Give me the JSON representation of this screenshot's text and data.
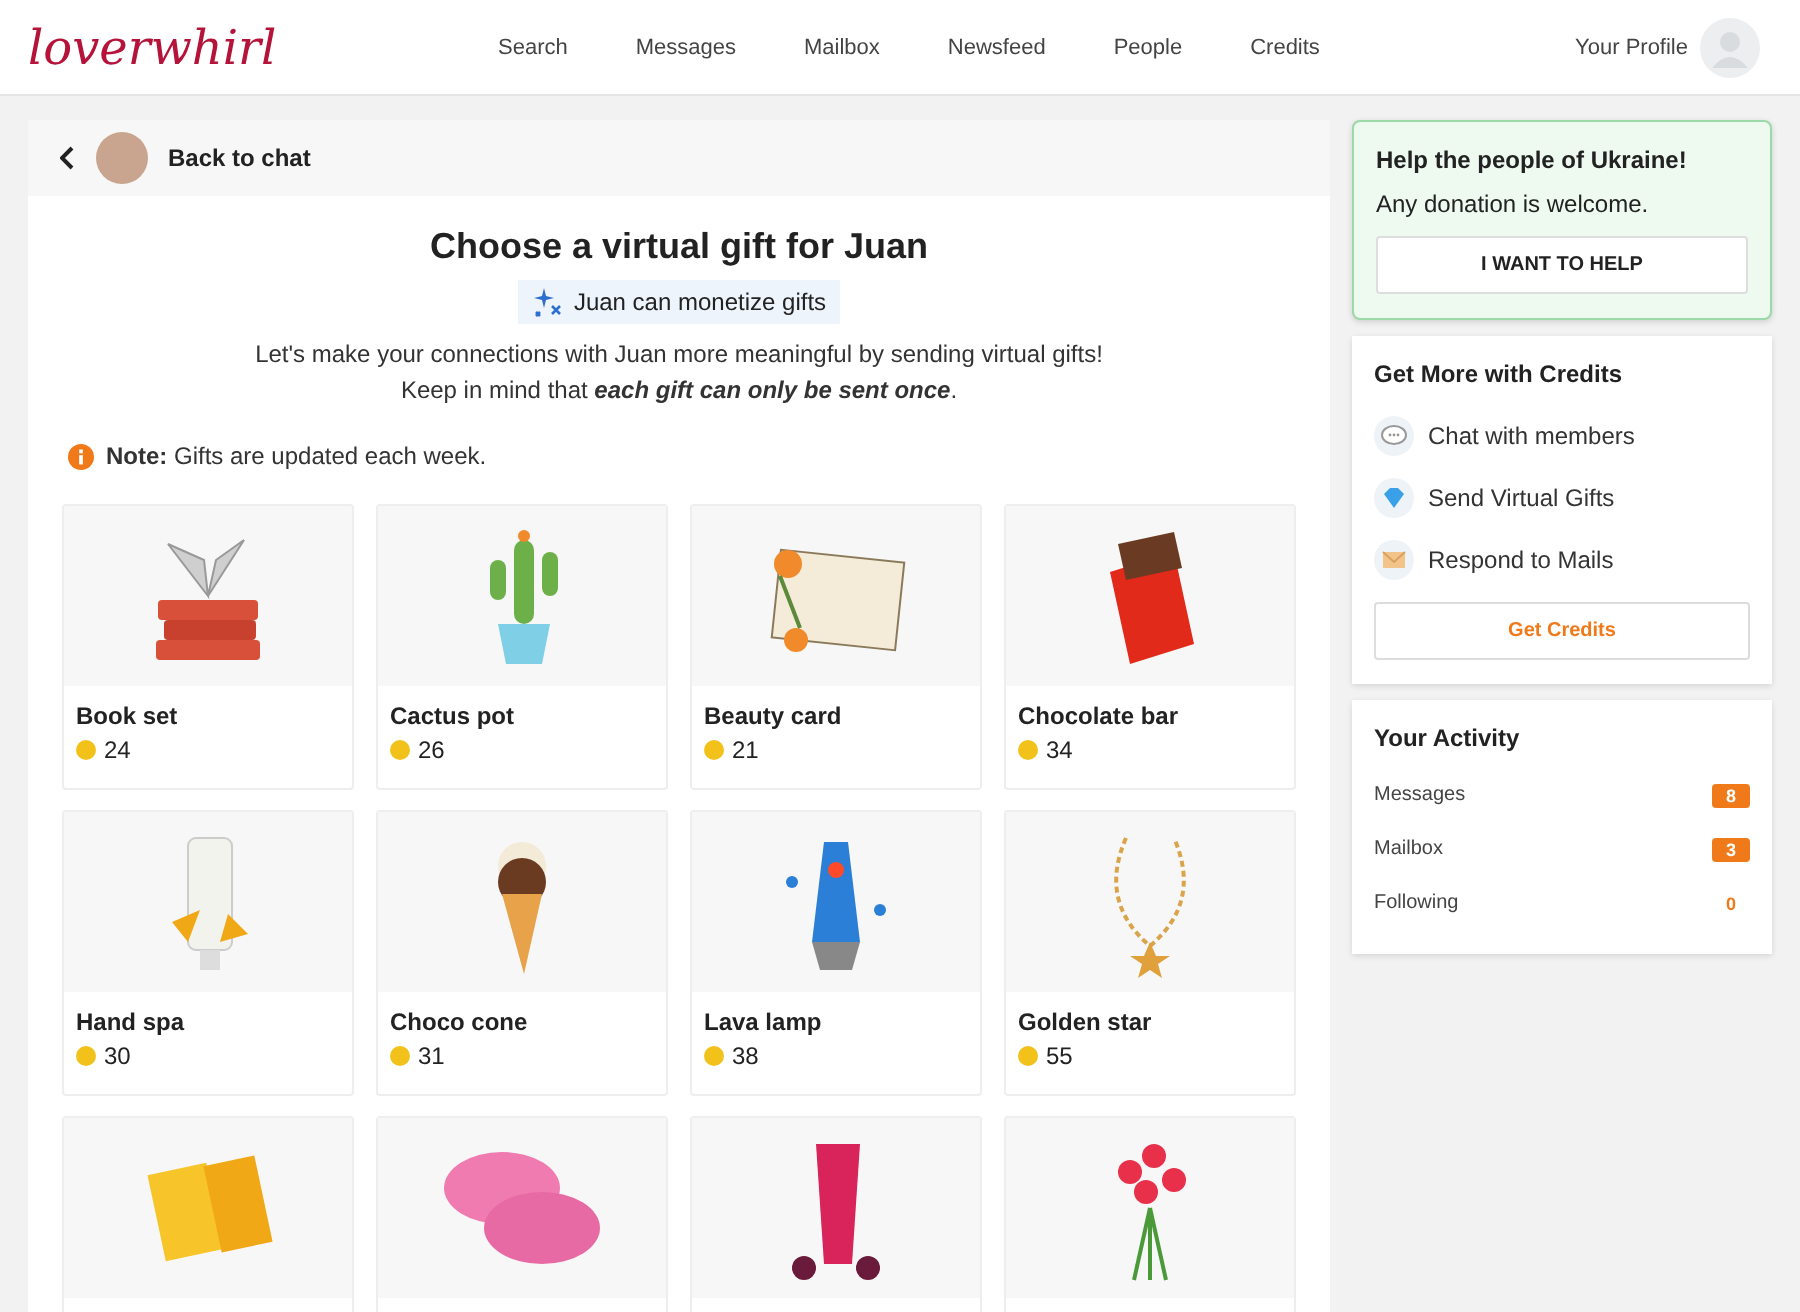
{
  "header": {
    "logo": "loverwhirl",
    "nav": [
      {
        "label": "Search",
        "selected": false
      },
      {
        "label": "Messages",
        "selected": false
      },
      {
        "label": "Mailbox",
        "selected": false
      },
      {
        "label": "Newsfeed",
        "selected": false
      },
      {
        "label": "People",
        "selected": false
      },
      {
        "label": "Credits",
        "selected": false
      }
    ],
    "profile": "Your Profile"
  },
  "back": {
    "label": "Back to chat"
  },
  "title": "Choose a virtual gift for Juan",
  "monetize_badge": "Juan can monetize gifts",
  "intro": [
    "Let's make your connections with Juan more meaningful by sending virtual gifts!",
    "Keep in mind that *each gift can only be sent once*."
  ],
  "note": "**Note:** Gifts are updated each week.",
  "gifts": [
    {
      "kind": "books",
      "name": "Book set",
      "price": "24"
    },
    {
      "kind": "cactus",
      "name": "Cactus pot",
      "price": "26"
    },
    {
      "kind": "card",
      "name": "Beauty card",
      "price": "21"
    },
    {
      "kind": "chocolate",
      "name": "Chocolate bar",
      "price": "34"
    },
    {
      "kind": "cream",
      "name": "Hand spa",
      "price": "30"
    },
    {
      "kind": "icecream",
      "name": "Choco cone",
      "price": "31"
    },
    {
      "kind": "lamp",
      "name": "Lava lamp",
      "price": "38"
    },
    {
      "kind": "necklace",
      "name": "Golden star",
      "price": "55"
    },
    {
      "kind": "notebook"
    },
    {
      "kind": "slippers"
    },
    {
      "kind": "juice"
    },
    {
      "kind": "flowers"
    }
  ],
  "ukraine": {
    "title": "Help the people of Ukraine!",
    "text": "Any donation is welcome.",
    "button": "I WANT TO HELP"
  },
  "credits": {
    "title": "Get More with Credits",
    "items": [
      {
        "kind": "chat",
        "label": "Chat with members"
      },
      {
        "kind": "gem",
        "label": "Send Virtual Gifts"
      },
      {
        "kind": "mail",
        "label": "Respond to Mails"
      }
    ],
    "button": "Get Credits"
  },
  "activity": {
    "title": "Your Activity",
    "rows": [
      {
        "label": "Messages",
        "count": "8",
        "highlight": true
      },
      {
        "label": "Mailbox",
        "count": "3",
        "highlight": true
      },
      {
        "label": "Following",
        "count": "0",
        "highlight": false
      }
    ]
  }
}
